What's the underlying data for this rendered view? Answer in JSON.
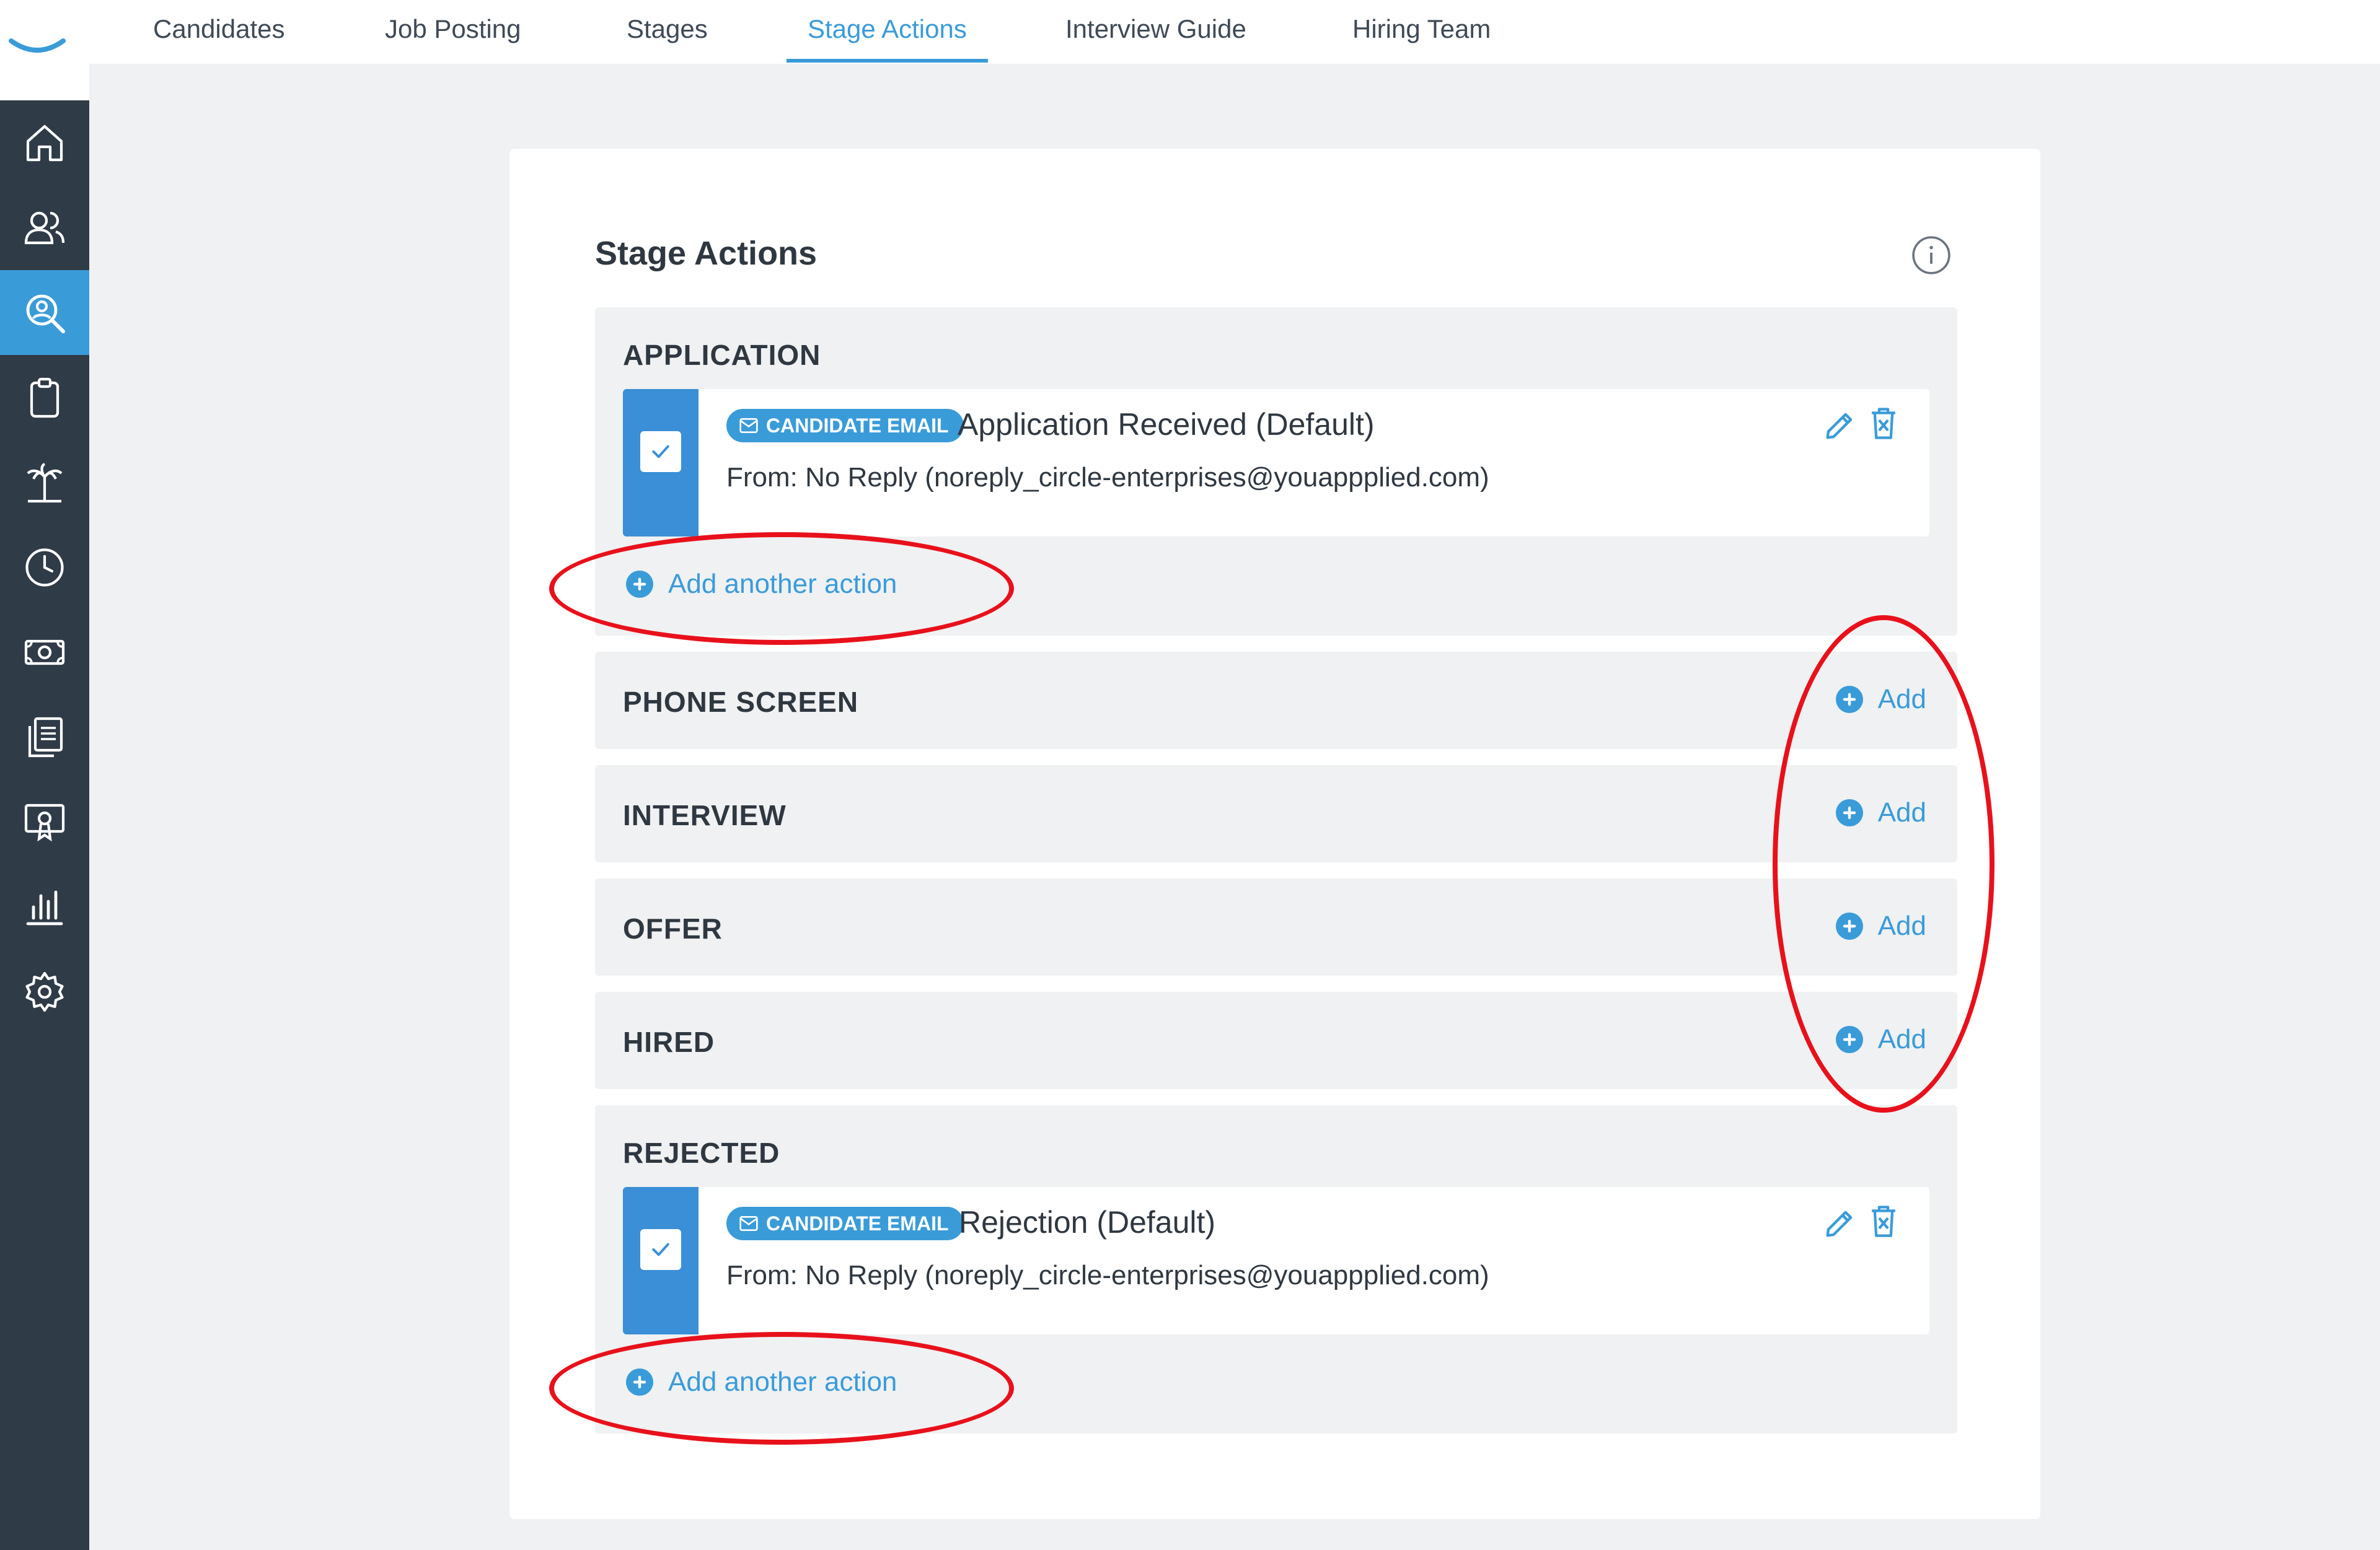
{
  "nav": {
    "tabs": [
      {
        "label": "Candidates"
      },
      {
        "label": "Job Posting"
      },
      {
        "label": "Stages"
      },
      {
        "label": "Stage Actions",
        "active": true
      },
      {
        "label": "Interview Guide"
      },
      {
        "label": "Hiring Team"
      }
    ]
  },
  "sidebar": {
    "items": [
      {
        "icon": "home-icon"
      },
      {
        "icon": "people-icon"
      },
      {
        "icon": "search-person-icon",
        "active": true
      },
      {
        "icon": "clipboard-icon"
      },
      {
        "icon": "palm-tree-icon"
      },
      {
        "icon": "clock-icon"
      },
      {
        "icon": "money-icon"
      },
      {
        "icon": "documents-icon"
      },
      {
        "icon": "certificate-icon"
      },
      {
        "icon": "bar-chart-icon"
      },
      {
        "icon": "gear-icon"
      }
    ]
  },
  "card": {
    "title": "Stage Actions",
    "add_another_label": "Add another action",
    "add_label": "Add",
    "sections": {
      "application": {
        "label": "APPLICATION",
        "action": {
          "badge": "CANDIDATE EMAIL",
          "title": "Application Received (Default)",
          "from": "From: No Reply (noreply_circle-enterprises@youappplied.com)"
        }
      },
      "phone_screen": {
        "label": "PHONE SCREEN"
      },
      "interview": {
        "label": "INTERVIEW"
      },
      "offer": {
        "label": "OFFER"
      },
      "hired": {
        "label": "HIRED"
      },
      "rejected": {
        "label": "REJECTED",
        "action": {
          "badge": "CANDIDATE EMAIL",
          "title": "Rejection (Default)",
          "from": "From: No Reply (noreply_circle-enterprises@youappplied.com)"
        }
      }
    }
  },
  "colors": {
    "accent": "#3a9bd9",
    "sidebar_bg": "#2f3b47",
    "annotation_red": "#e8111b"
  }
}
